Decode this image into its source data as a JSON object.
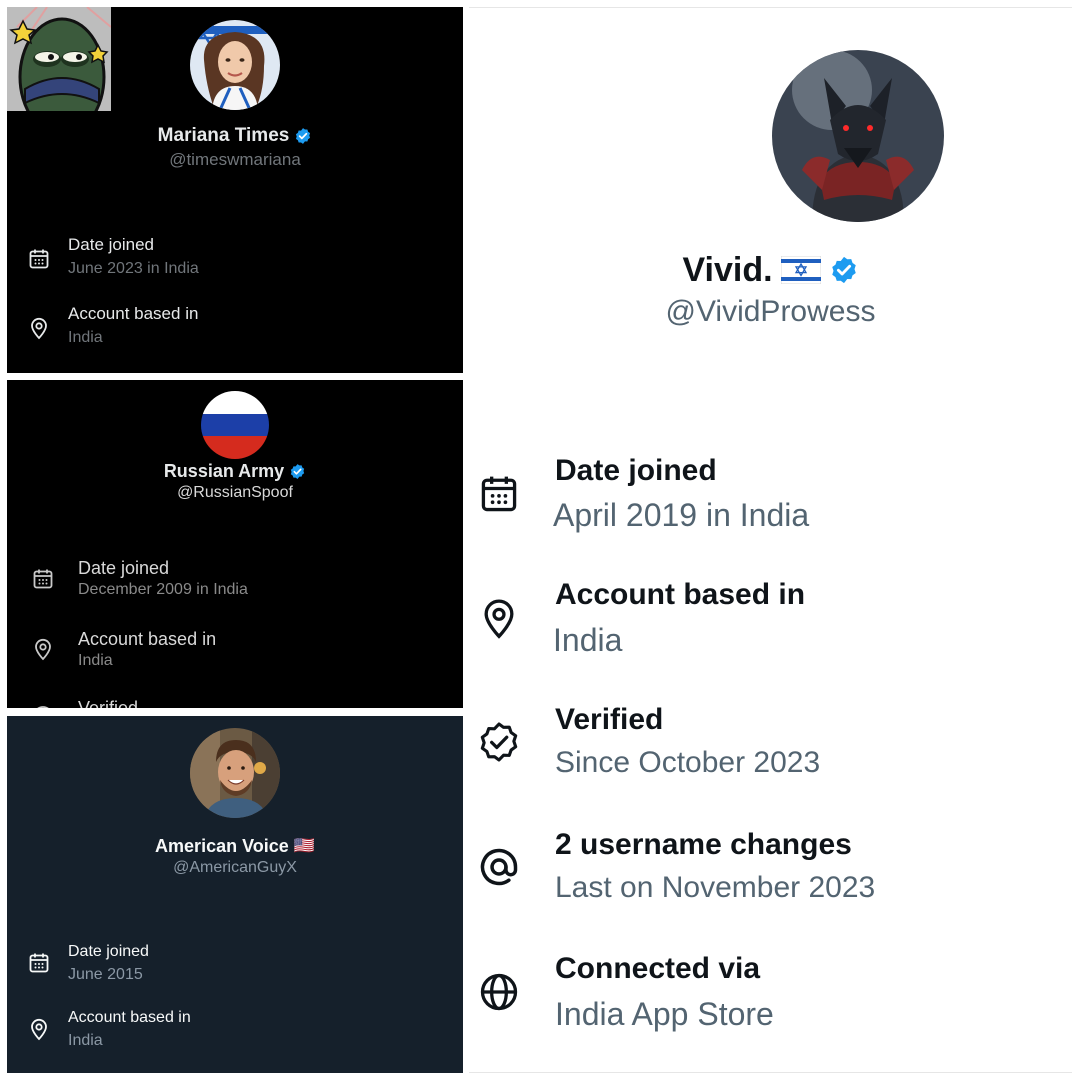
{
  "profiles": [
    {
      "name": "Mariana Times",
      "handle": "@timeswmariana",
      "verified": true,
      "rows": [
        {
          "icon": "calendar-icon",
          "label": "Date joined",
          "value": "June 2023 in India"
        },
        {
          "icon": "location-pin-icon",
          "label": "Account based in",
          "value": "India"
        }
      ]
    },
    {
      "name": "Russian Army",
      "handle": "@RussianSpoof",
      "verified": true,
      "rows": [
        {
          "icon": "calendar-icon",
          "label": "Date joined",
          "value": "December 2009 in India"
        },
        {
          "icon": "location-pin-icon",
          "label": "Account based in",
          "value": "India"
        },
        {
          "icon": "verified-icon",
          "label": "Verified",
          "value": ""
        }
      ]
    },
    {
      "name": "American Voice",
      "flag": "🇺🇸",
      "handle": "@AmericanGuyX",
      "verified": false,
      "rows": [
        {
          "icon": "calendar-icon",
          "label": "Date joined",
          "value": "June 2015"
        },
        {
          "icon": "location-pin-icon",
          "label": "Account based in",
          "value": "India"
        }
      ]
    },
    {
      "name": "Vivid.",
      "flag": "🇮🇱",
      "handle": "@VividProwess",
      "verified": true,
      "rows": [
        {
          "icon": "calendar-icon",
          "label": "Date joined",
          "value": "April 2019 in India"
        },
        {
          "icon": "location-pin-icon",
          "label": "Account based in",
          "value": "India"
        },
        {
          "icon": "verified-seal-icon",
          "label": "Verified",
          "value": "Since October 2023"
        },
        {
          "icon": "at-sign-icon",
          "label": "2 username changes",
          "value": "Last on November 2023"
        },
        {
          "icon": "globe-icon",
          "label": "Connected via",
          "value": "India App Store"
        }
      ]
    }
  ],
  "colors": {
    "verified_blue": "#1d9bf0",
    "dark_bg": "#000000",
    "dim_bg": "#15202b",
    "light_bg": "#ffffff"
  }
}
